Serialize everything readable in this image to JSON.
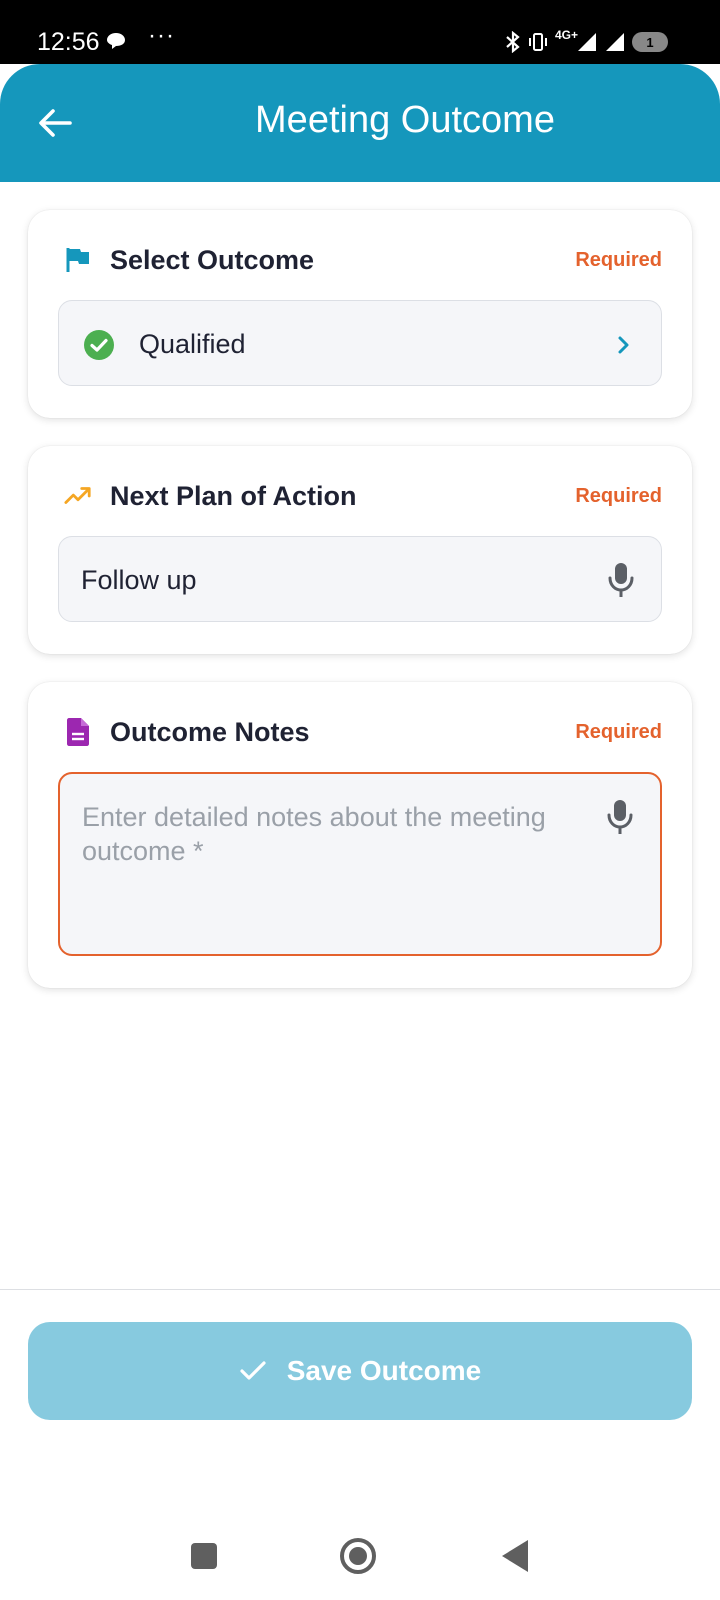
{
  "status_bar": {
    "time": "12:56",
    "overflow": "···",
    "network": "4G+",
    "battery": "1"
  },
  "header": {
    "title": "Meeting Outcome",
    "back_icon": "arrow-left-icon"
  },
  "outcome_card": {
    "title": "Select Outcome",
    "required": "Required",
    "icon": "flag-icon",
    "selected_value": "Qualified",
    "accent": "#1597bc",
    "status_color": "#4caf50"
  },
  "plan_card": {
    "title": "Next Plan of Action",
    "required": "Required",
    "icon": "trending-up-icon",
    "value": "Follow up",
    "accent": "#f5a623"
  },
  "notes_card": {
    "title": "Outcome Notes",
    "required": "Required",
    "icon": "document-icon",
    "placeholder": "Enter detailed notes about the meeting outcome *",
    "value": "",
    "accent": "#9c27b0"
  },
  "save_button": {
    "label": "Save Outcome",
    "icon": "check-icon",
    "color": "#87cadf"
  },
  "colors": {
    "required": "#e4622d",
    "header": "#1597bc"
  }
}
